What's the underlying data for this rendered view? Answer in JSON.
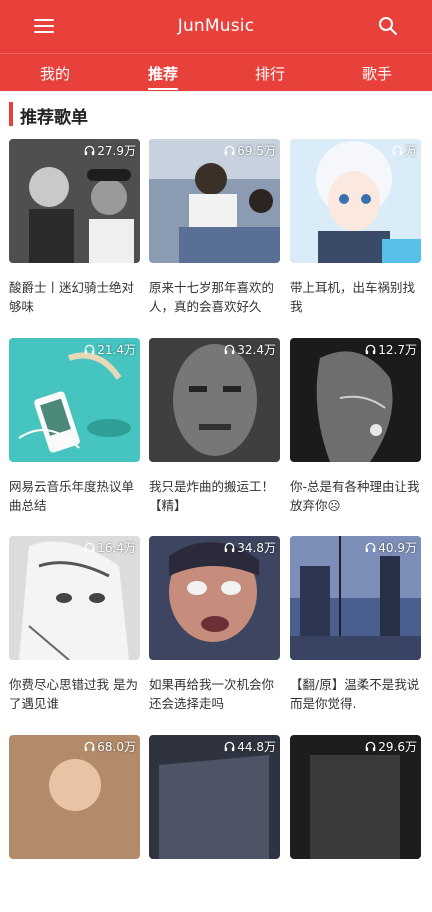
{
  "app": {
    "title": "JunMusic"
  },
  "tabs": [
    {
      "label": "我的"
    },
    {
      "label": "推荐"
    },
    {
      "label": "排行"
    },
    {
      "label": "歌手"
    }
  ],
  "active_tab": "推荐",
  "section": {
    "title": "推荐歌单"
  },
  "icons": {
    "menu": "menu-icon",
    "search": "search-icon",
    "play_count": "headphones-icon"
  },
  "colors": {
    "brand": "#e8403a",
    "text": "#333333"
  },
  "playlists": [
    {
      "count": "27.9万",
      "title": "酸爵士丨迷幻骑士绝对够味"
    },
    {
      "count": "69.5万",
      "title": "原来十七岁那年喜欢的人，真的会喜欢好久"
    },
    {
      "count": "万",
      "title": "带上耳机，出车祸别找我"
    },
    {
      "count": "21.4万",
      "title": "网易云音乐年度热议单曲总结"
    },
    {
      "count": "32.4万",
      "title": "我只是炸曲的搬运工！【精】"
    },
    {
      "count": "12.7万",
      "title": "你-总是有各种理由让我放弃你☹"
    },
    {
      "count": "16.4万",
      "title": "你费尽心思错过我 是为了遇见谁"
    },
    {
      "count": "34.8万",
      "title": "如果再给我一次机会你还会选择走吗"
    },
    {
      "count": "40.9万",
      "title": "【翻/原】温柔不是我说而是你觉得."
    },
    {
      "count": "68.0万",
      "title": ""
    },
    {
      "count": "44.8万",
      "title": ""
    },
    {
      "count": "29.6万",
      "title": ""
    }
  ]
}
